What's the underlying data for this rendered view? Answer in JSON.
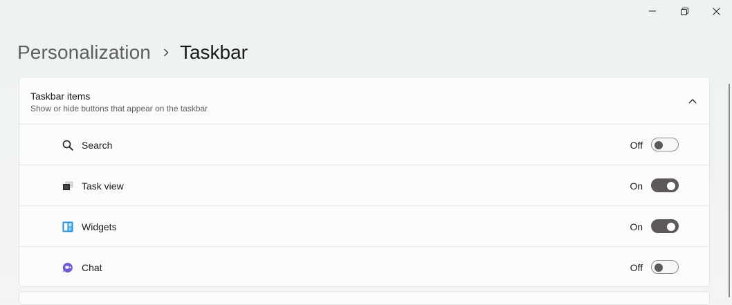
{
  "window": {
    "caption": {
      "minimize_icon": "minimize-icon",
      "maximize_icon": "restore-icon",
      "close_icon": "close-icon"
    }
  },
  "breadcrumb": {
    "parent": "Personalization",
    "separator_icon": "chevron-right-icon",
    "current": "Taskbar"
  },
  "section": {
    "title": "Taskbar items",
    "subtitle": "Show or hide buttons that appear on the taskbar",
    "collapse_icon": "chevron-up-icon",
    "items": [
      {
        "label": "Search",
        "icon": "search-icon",
        "state_label": "Off",
        "on": false
      },
      {
        "label": "Task view",
        "icon": "task-view-icon",
        "state_label": "On",
        "on": true
      },
      {
        "label": "Widgets",
        "icon": "widgets-icon",
        "state_label": "On",
        "on": true
      },
      {
        "label": "Chat",
        "icon": "chat-icon",
        "state_label": "Off",
        "on": false
      }
    ]
  },
  "colors": {
    "toggle_on": "#5e5858",
    "toggle_off_border": "#8a8a8a",
    "widgets_icon": "#1f8fe0",
    "chat_icon": "#6b5cd6"
  }
}
